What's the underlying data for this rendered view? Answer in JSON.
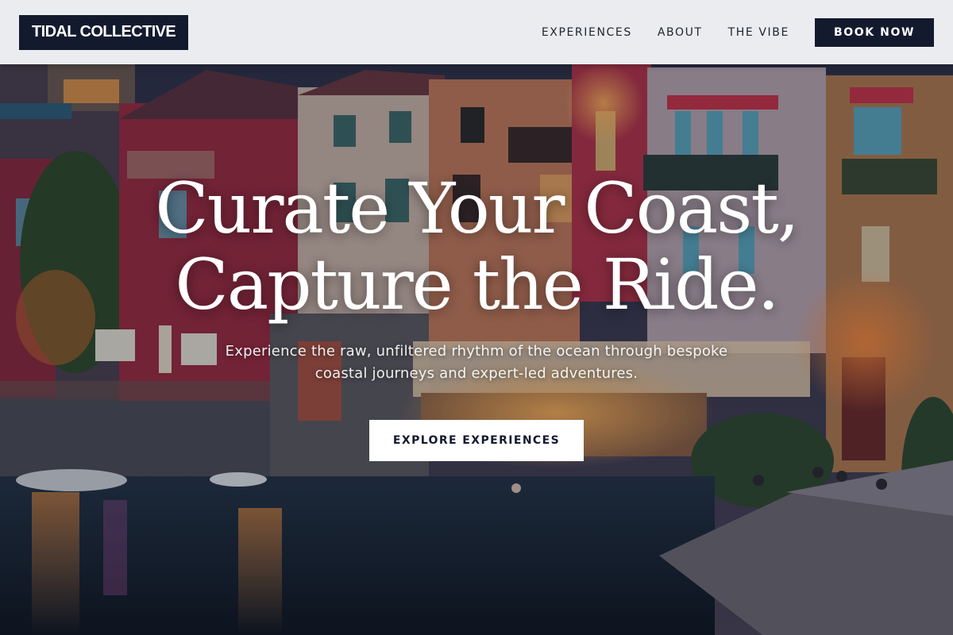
{
  "brand": {
    "logo_text": "TIDAL COLLECTIVE"
  },
  "nav": {
    "items": [
      {
        "label": "EXPERIENCES"
      },
      {
        "label": "ABOUT"
      },
      {
        "label": "THE VIBE"
      }
    ],
    "book_label": "BOOK NOW"
  },
  "hero": {
    "headline_line1": "Curate Your Coast,",
    "headline_line2": "Capture the Ride.",
    "subline": "Experience the raw, unfiltered rhythm of the ocean through bespoke coastal journeys and expert-led adventures.",
    "cta_label": "EXPLORE EXPERIENCES",
    "image_subject": "lakeside-village-at-dusk"
  },
  "colors": {
    "navy": "#141a2e",
    "header_bg": "#f4f5f7",
    "white": "#ffffff"
  }
}
